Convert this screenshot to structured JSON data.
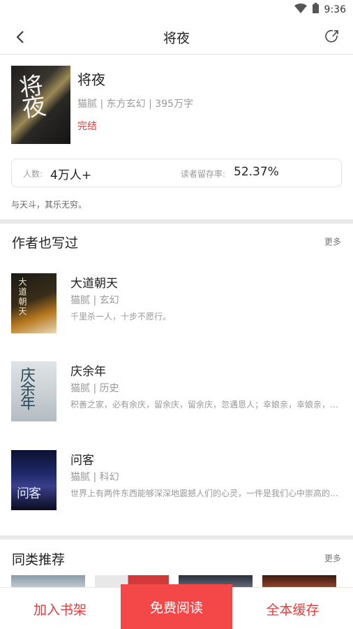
{
  "status_bar": {
    "time": "9:36"
  },
  "nav": {
    "title": "将夜"
  },
  "book": {
    "title": "将夜",
    "cover_text": "将夜",
    "author": "猫腻",
    "genre": "东方玄幻",
    "word_count": "395万字",
    "status": "完结",
    "intro": "与天斗，其乐无穷。"
  },
  "stats": {
    "readers_label": "人数:",
    "readers_value": "4万人+",
    "retention_label": "读者留存率:",
    "retention_value": "52.37%"
  },
  "author_works": {
    "title": "作者也写过",
    "more": "更多",
    "items": [
      {
        "title": "大道朝天",
        "author": "猫腻",
        "genre": "玄幻",
        "desc": "千里杀一人，十步不愿行。",
        "cover_text": "大道朝天"
      },
      {
        "title": "庆余年",
        "author": "猫腻",
        "genre": "历史",
        "desc": "积善之家，必有余庆，留余庆，留余庆，忽遇恩人；幸娘亲，幸娘亲，留余庆",
        "cover_text": "庆余年"
      },
      {
        "title": "问客",
        "author": "猫腻",
        "genre": "科幻",
        "desc": "世界上有两件东西能够深深地震撼人们的心灵，一件是我们心中崇高的道德准则",
        "cover_text": "问客"
      }
    ]
  },
  "similar": {
    "title": "同类推荐",
    "more": "更多"
  },
  "actions": {
    "add_shelf": "加入书架",
    "free_read": "免费阅读",
    "cache_all": "全本缓存"
  },
  "colors": {
    "accent": "#e23b3b",
    "read_button": "#f44848"
  }
}
